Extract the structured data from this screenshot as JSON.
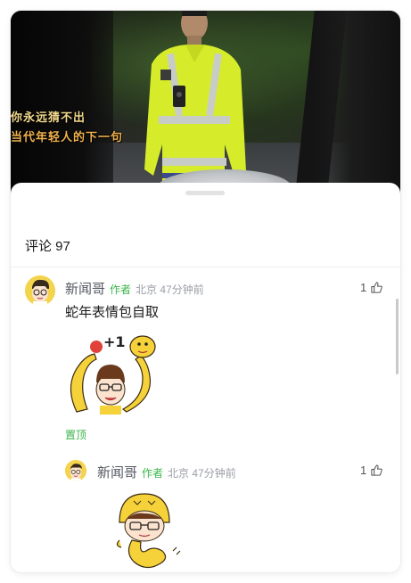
{
  "video": {
    "caption_line1": "你永远猜不出",
    "caption_line2": "当代年轻人的下一句"
  },
  "comments": {
    "title": "评论 97",
    "items": [
      {
        "author": "新闻哥",
        "tag": "作者",
        "meta": "北京 47分钟前",
        "likes": "1",
        "text": "蛇年表情包自取",
        "sticker_text": "+1",
        "pinned_label": "置顶"
      },
      {
        "author": "新闻哥",
        "tag": "作者",
        "meta": "北京 47分钟前",
        "likes": "1"
      }
    ]
  },
  "icons": {
    "like": "thumbs-up-icon",
    "avatar": "cartoon-face-avatar"
  },
  "colors": {
    "author_tag": "#3ab54a",
    "pinned": "#3ab54a",
    "snake": "#f5d23a",
    "vest": "#d8ef2a"
  }
}
